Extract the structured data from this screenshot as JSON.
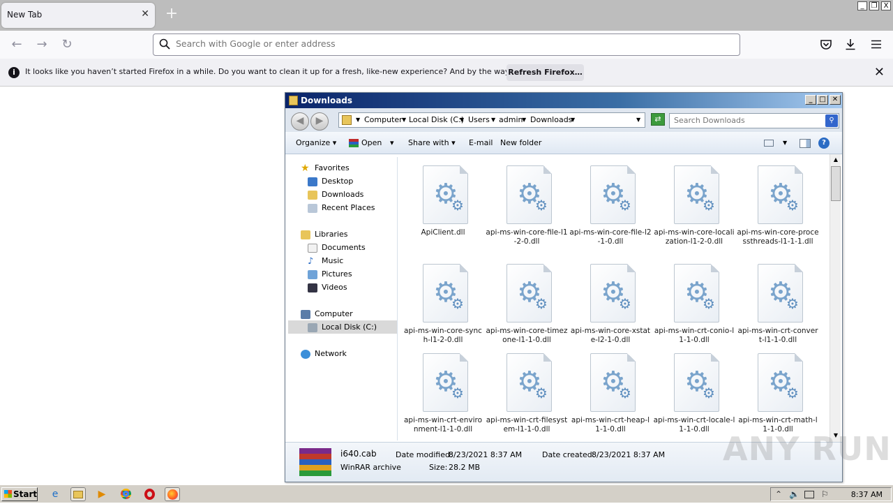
{
  "browser": {
    "tab_title": "New Tab",
    "url_placeholder": "Search with Google or enter address",
    "notification": {
      "message": "It looks like you haven’t started Firefox in a while. Do you want to clean it up for a fresh, like-new experience? And by the way, welcome back!",
      "button": "Refresh Firefox…"
    },
    "window_controls": [
      "_",
      "❐",
      "X"
    ]
  },
  "explorer": {
    "title": "Downloads",
    "breadcrumb": [
      "Computer",
      "Local Disk (C:)",
      "Users",
      "admin",
      "Downloads"
    ],
    "search_placeholder": "Search Downloads",
    "toolbar": {
      "organize": "Organize",
      "open": "Open",
      "share_with": "Share with",
      "email": "E-mail",
      "new_folder": "New folder"
    },
    "nav": {
      "favorites": "Favorites",
      "desktop": "Desktop",
      "downloads": "Downloads",
      "recent": "Recent Places",
      "libraries": "Libraries",
      "documents": "Documents",
      "music": "Music",
      "pictures": "Pictures",
      "videos": "Videos",
      "computer": "Computer",
      "local_disk": "Local Disk (C:)",
      "network": "Network"
    },
    "files": [
      "ApiClient.dll",
      "api-ms-win-core-file-l1-2-0.dll",
      "api-ms-win-core-file-l2-1-0.dll",
      "api-ms-win-core-localization-l1-2-0.dll",
      "api-ms-win-core-processthreads-l1-1-1.dll",
      "api-ms-win-core-synch-l1-2-0.dll",
      "api-ms-win-core-timezone-l1-1-0.dll",
      "api-ms-win-core-xstate-l2-1-0.dll",
      "api-ms-win-crt-conio-l1-1-0.dll",
      "api-ms-win-crt-convert-l1-1-0.dll",
      "api-ms-win-crt-environment-l1-1-0.dll",
      "api-ms-win-crt-filesystem-l1-1-0.dll",
      "api-ms-win-crt-heap-l1-1-0.dll",
      "api-ms-win-crt-locale-l1-1-0.dll",
      "api-ms-win-crt-math-l1-1-0.dll"
    ],
    "details": {
      "filename": "i640.cab",
      "type": "WinRAR archive",
      "modified_label": "Date modified:",
      "modified": "8/23/2021 8:37 AM",
      "created_label": "Date created:",
      "created": "8/23/2021 8:37 AM",
      "size_label": "Size:",
      "size": "28.2 MB"
    }
  },
  "watermark": "ANY RUN",
  "taskbar": {
    "start": "Start",
    "clock": "8:37 AM"
  }
}
